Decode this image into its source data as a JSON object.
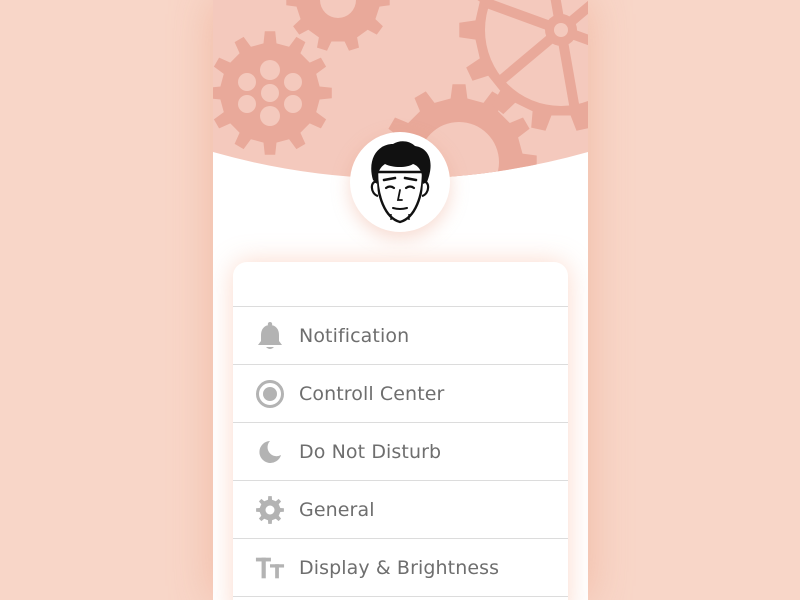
{
  "theme": {
    "background": "#f8d6c8",
    "header_bg": "#f4c9bd",
    "gear_color": "#e9a99a",
    "icon_color": "#b3b3b3",
    "label_color": "#6e6e6e"
  },
  "profile": {
    "avatar_icon": "avatar-face-icon"
  },
  "menu": {
    "items": [
      {
        "label": "Notification",
        "icon": "bell-icon"
      },
      {
        "label": "Controll Center",
        "icon": "control-center-icon"
      },
      {
        "label": "Do Not Disturb",
        "icon": "moon-icon"
      },
      {
        "label": "General",
        "icon": "gear-icon"
      },
      {
        "label": "Display & Brightness",
        "icon": "text-size-icon"
      }
    ]
  }
}
